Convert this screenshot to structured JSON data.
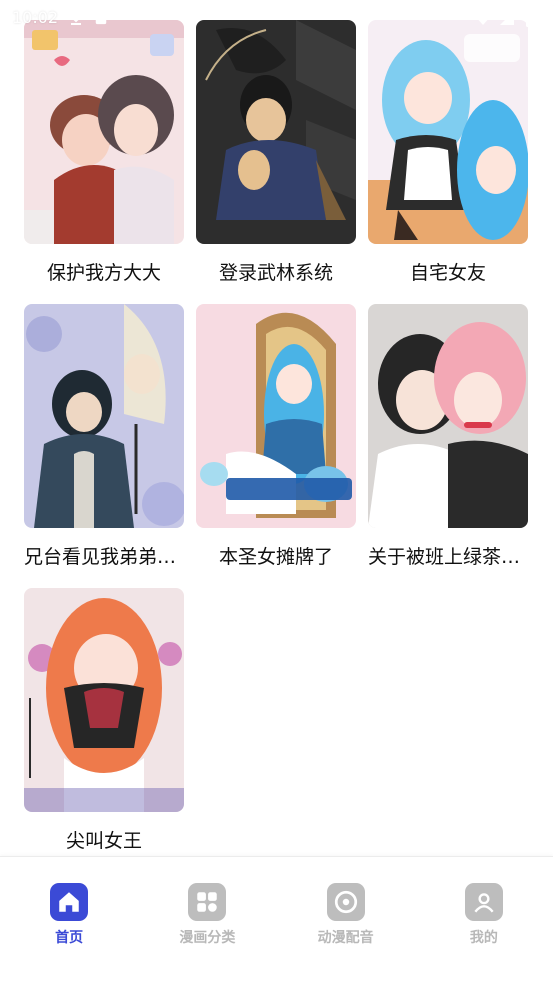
{
  "status_bar": {
    "time": "10:02",
    "icons": [
      "download-icon",
      "sim-card-icon",
      "wifi-icon",
      "signal-icon",
      "battery-icon"
    ]
  },
  "comics": [
    {
      "title": "保护我方大大",
      "cover_art": "romance-couple-cover",
      "colors": [
        "#f3d7da",
        "#c98c84",
        "#5b3e3c"
      ]
    },
    {
      "title": "登录武林系统",
      "cover_art": "martial-hero-cover",
      "colors": [
        "#2c2c2c",
        "#3a4668",
        "#c9a76e"
      ]
    },
    {
      "title": "自宅女友",
      "cover_art": "maid-girls-cover",
      "colors": [
        "#f4e9f2",
        "#6ec6ee",
        "#2b2b2b"
      ]
    },
    {
      "title": "兄台看见我弟弟了吗",
      "cover_art": "swordsmen-cover",
      "colors": [
        "#c9c6e6",
        "#2f3e4e",
        "#efe9d8"
      ]
    },
    {
      "title": "本圣女摊牌了",
      "cover_art": "saint-girl-cover",
      "colors": [
        "#f6d6e0",
        "#4bb8e8",
        "#b88f5c"
      ]
    },
    {
      "title": "关于被班上绿茶同学缠上这件事",
      "cover_art": "classmates-cover",
      "colors": [
        "#cfcfcf",
        "#f2a7b4",
        "#2a2a2a"
      ]
    },
    {
      "title": "尖叫女王",
      "cover_art": "screaming-queen-cover",
      "colors": [
        "#f0e3e4",
        "#ef7a4a",
        "#8c2d36"
      ]
    }
  ],
  "nav": [
    {
      "label": "首页",
      "icon": "home-icon",
      "active": true
    },
    {
      "label": "漫画分类",
      "icon": "category-grid-icon",
      "active": false
    },
    {
      "label": "动漫配音",
      "icon": "disc-icon",
      "active": false
    },
    {
      "label": "我的",
      "icon": "profile-icon",
      "active": false
    }
  ],
  "colors": {
    "accent": "#3b4ad6",
    "nav_inactive": "#b8b8b8"
  }
}
